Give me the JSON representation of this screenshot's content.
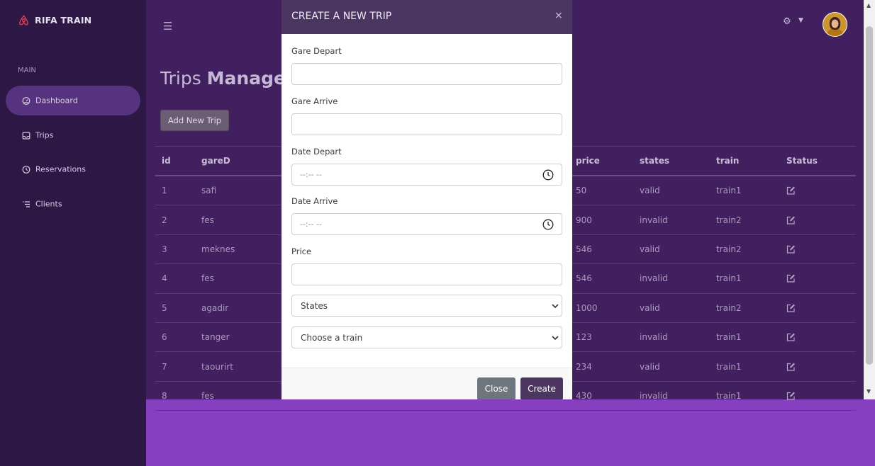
{
  "brand": {
    "name": "RIFA TRAIN"
  },
  "sidebar": {
    "section_label": "MAIN",
    "items": [
      {
        "label": "Dashboard",
        "icon": "dashboard-icon",
        "active": true
      },
      {
        "label": "Trips",
        "icon": "inbox-icon"
      },
      {
        "label": "Reservations",
        "icon": "clock-icon"
      },
      {
        "label": "Clients",
        "icon": "list-icon"
      }
    ]
  },
  "header": {
    "menu_icon": "hamburger-icon",
    "settings_icon": "gear-icon",
    "avatar": "user-avatar"
  },
  "page": {
    "title_light": "Trips",
    "title_bold": "Manager",
    "add_button": "Add New Trip"
  },
  "table": {
    "headers": {
      "id": "id",
      "gareD": "gareD",
      "price": "price",
      "states": "states",
      "train": "train",
      "status": "Status"
    },
    "rows": [
      {
        "id": "1",
        "gareD": "safi",
        "price": "50",
        "states": "valid",
        "train": "train1"
      },
      {
        "id": "2",
        "gareD": "fes",
        "price": "900",
        "states": "invalid",
        "train": "train2"
      },
      {
        "id": "3",
        "gareD": "meknes",
        "price": "546",
        "states": "valid",
        "train": "train2"
      },
      {
        "id": "4",
        "gareD": "fes",
        "price": "546",
        "states": "invalid",
        "train": "train1"
      },
      {
        "id": "5",
        "gareD": "agadir",
        "price": "1000",
        "states": "valid",
        "train": "train2"
      },
      {
        "id": "6",
        "gareD": "tanger",
        "price": "123",
        "states": "invalid",
        "train": "train1"
      },
      {
        "id": "7",
        "gareD": "taourirt",
        "price": "234",
        "states": "valid",
        "train": "train1"
      },
      {
        "id": "8",
        "gareD": "fes",
        "price": "430",
        "states": "invalid",
        "train": "train1"
      }
    ]
  },
  "modal": {
    "title": "CREATE A NEW TRIP",
    "close_symbol": "×",
    "fields": {
      "gare_depart": {
        "label": "Gare Depart",
        "value": ""
      },
      "gare_arrive": {
        "label": "Gare Arrive",
        "value": ""
      },
      "date_depart": {
        "label": "Date Depart",
        "placeholder": "--:-- --"
      },
      "date_arrive": {
        "label": "Date Arrive",
        "placeholder": "--:-- --"
      },
      "price": {
        "label": "Price",
        "value": ""
      }
    },
    "states_select": "States",
    "train_select": "Choose a train",
    "close_button": "Close",
    "create_button": "Create"
  },
  "colors": {
    "sidebar": "#2d1745",
    "main": "#421f5e",
    "modal_header": "#4b3561",
    "accent": "#863fbe"
  }
}
